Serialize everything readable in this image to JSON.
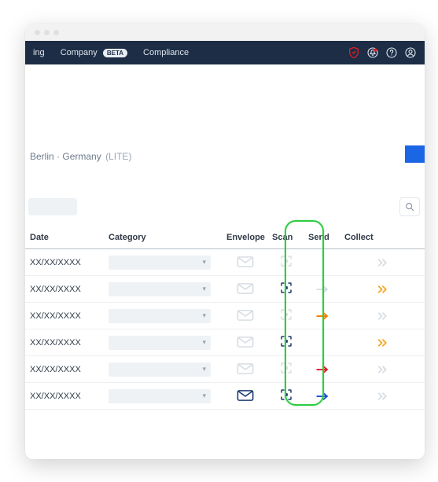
{
  "nav": {
    "item_ing": "ing",
    "item_company": "Company",
    "badge": "BETA",
    "item_compliance": "Compliance"
  },
  "location": {
    "city": "Berlin",
    "sep": " · ",
    "country": "Germany",
    "plan": "(LITE)"
  },
  "search": {
    "placeholder": "Search"
  },
  "columns": {
    "date": "Date",
    "category": "Category",
    "envelope": "Envelope",
    "scan": "Scan",
    "send": "Send",
    "collect": "Collect"
  },
  "rows": [
    {
      "date": "XX/XX/XXXX",
      "envelope": "inactive",
      "scan": "inactive",
      "send": "none",
      "collect": "inactive"
    },
    {
      "date": "XX/XX/XXXX",
      "envelope": "inactive",
      "scan": "active",
      "send": "faded",
      "collect": "amber"
    },
    {
      "date": "XX/XX/XXXX",
      "envelope": "inactive",
      "scan": "inactive",
      "send": "orange",
      "collect": "inactive"
    },
    {
      "date": "XX/XX/XXXX",
      "envelope": "inactive",
      "scan": "active",
      "send": "none",
      "collect": "amber"
    },
    {
      "date": "XX/XX/XXXX",
      "envelope": "inactive",
      "scan": "inactive",
      "send": "red",
      "collect": "inactive"
    },
    {
      "date": "XX/XX/XXXX",
      "envelope": "active",
      "scan": "active",
      "send": "blue",
      "collect": "inactive"
    }
  ],
  "colors": {
    "blue": "#1b3b6f",
    "amber": "#f5a623",
    "orange": "#ff7a00",
    "red": "#e01b24",
    "darkblue": "#1d4ed8",
    "mute": "#d7dde3",
    "green": "#2ecc40"
  }
}
